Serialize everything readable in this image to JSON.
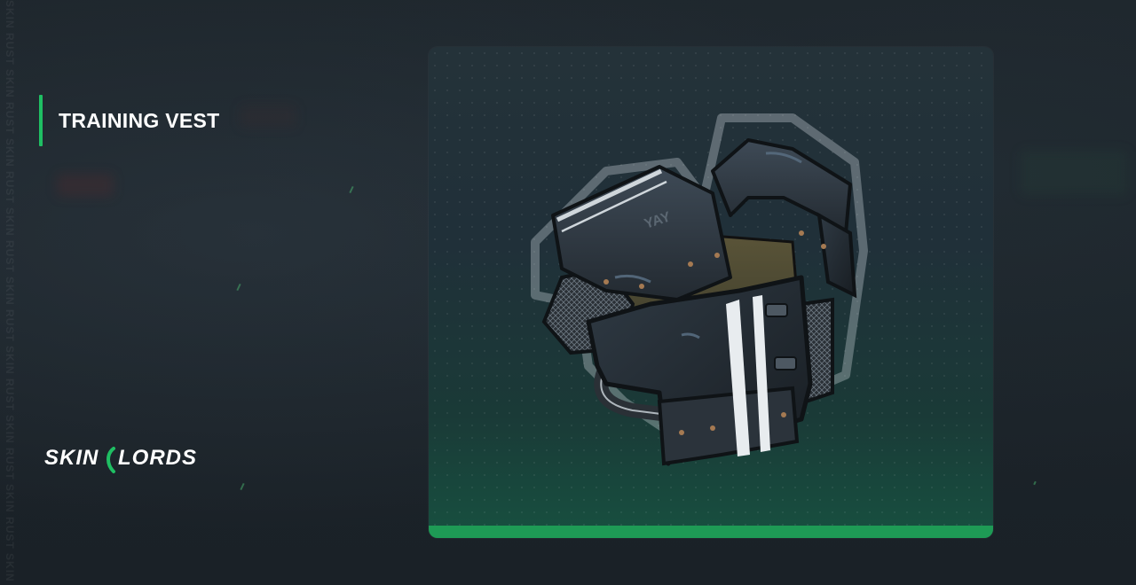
{
  "item": {
    "name": "TRAINING VEST"
  },
  "brand": {
    "name": "SKINLORDS",
    "accent_color": "#1fbf63"
  },
  "watermark": {
    "text": "SKIN RUST SKIN RUST SKIN RUST SKIN RUST SKIN RUST SKIN RUST SKIN RUST SKIN RUST SKIN RUST SKIN RUST SKIN RUST SKIN RUST"
  },
  "card": {
    "bar_color": "#1e9a55",
    "image_icon": "armor-vest-icon"
  }
}
